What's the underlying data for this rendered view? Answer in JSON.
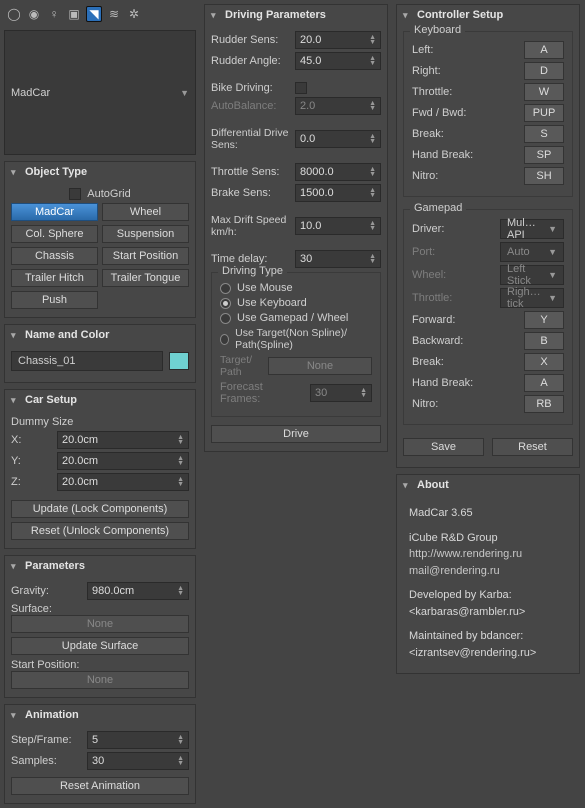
{
  "category_dropdown": "MadCar",
  "object_type": {
    "title": "Object Type",
    "autogrid": "AutoGrid",
    "buttons": [
      "MadCar",
      "Wheel",
      "Col. Sphere",
      "Suspension",
      "Chassis",
      "Start Position",
      "Trailer Hitch",
      "Trailer Tongue",
      "Push"
    ]
  },
  "name_color": {
    "title": "Name and Color",
    "name": "Chassis_01"
  },
  "car_setup": {
    "title": "Car Setup",
    "dummy": "Dummy Size",
    "x_label": "X:",
    "x": "20.0cm",
    "y_label": "Y:",
    "y": "20.0cm",
    "z_label": "Z:",
    "z": "20.0cm",
    "update": "Update (Lock Components)",
    "reset": "Reset (Unlock Components)"
  },
  "parameters": {
    "title": "Parameters",
    "gravity_label": "Gravity:",
    "gravity": "980.0cm",
    "surface_label": "Surface:",
    "none": "None",
    "update_surface": "Update Surface",
    "start_pos": "Start Position:"
  },
  "animation": {
    "title": "Animation",
    "step_label": "Step/Frame:",
    "step": "5",
    "samples_label": "Samples:",
    "samples": "30",
    "reset": "Reset Animation"
  },
  "driving": {
    "title": "Driving Parameters",
    "rudder_sens_label": "Rudder Sens:",
    "rudder_sens": "20.0",
    "rudder_angle_label": "Rudder Angle:",
    "rudder_angle": "45.0",
    "bike_label": "Bike Driving:",
    "autobal_label": "AutoBalance:",
    "autobal": "2.0",
    "diff_label": "Differential Drive Sens:",
    "diff": "0.0",
    "throttle_label": "Throttle Sens:",
    "throttle": "8000.0",
    "brake_label": "Brake Sens:",
    "brake": "1500.0",
    "maxdrift_label": "Max Drift Speed km/h:",
    "maxdrift": "10.0",
    "timedelay_label": "Time delay:",
    "timedelay": "30",
    "dtype_title": "Driving Type",
    "r_mouse": "Use Mouse",
    "r_keyboard": "Use Keyboard",
    "r_gamepad": "Use Gamepad / Wheel",
    "r_target": "Use Target(Non Spline)/ Path(Spline)",
    "targetpath_label": "Target/ Path",
    "none": "None",
    "forecast_label": "Forecast Frames:",
    "forecast": "30",
    "drive": "Drive"
  },
  "controller": {
    "title": "Controller Setup",
    "keyboard_title": "Keyboard",
    "left_label": "Left:",
    "left": "A",
    "right_label": "Right:",
    "right": "D",
    "throttle_label": "Throttle:",
    "throttle": "W",
    "fwdbwd_label": "Fwd / Bwd:",
    "fwdbwd": "PUP",
    "break_label": "Break:",
    "break": "S",
    "handbreak_label": "Hand Break:",
    "handbreak": "SP",
    "nitro_label": "Nitro:",
    "nitro": "SH",
    "gamepad_title": "Gamepad",
    "driver_label": "Driver:",
    "driver": "Mul…API",
    "port_label": "Port:",
    "port": "Auto",
    "wheel_label": "Wheel:",
    "wheel": "Left Stick",
    "gthrottle_label": "Throttle:",
    "gthrottle": "Righ…tick",
    "forward_label": "Forward:",
    "forward": "Y",
    "backward_label": "Backward:",
    "backward": "B",
    "gbreak_label": "Break:",
    "gbreak": "X",
    "ghandbreak_label": "Hand Break:",
    "ghandbreak": "A",
    "gnitro_label": "Nitro:",
    "gnitro": "RB",
    "save": "Save",
    "reset": "Reset"
  },
  "about": {
    "title": "About",
    "l1": "MadCar 3.65",
    "l2": "iCube R&D Group",
    "l3": "http://www.rendering.ru",
    "l4": "mail@rendering.ru",
    "l5": "Developed by Karba:",
    "l6": "<karbaras@rambler.ru>",
    "l7": "Maintained by bdancer:",
    "l8": "<izrantsev@rendering.ru>"
  }
}
